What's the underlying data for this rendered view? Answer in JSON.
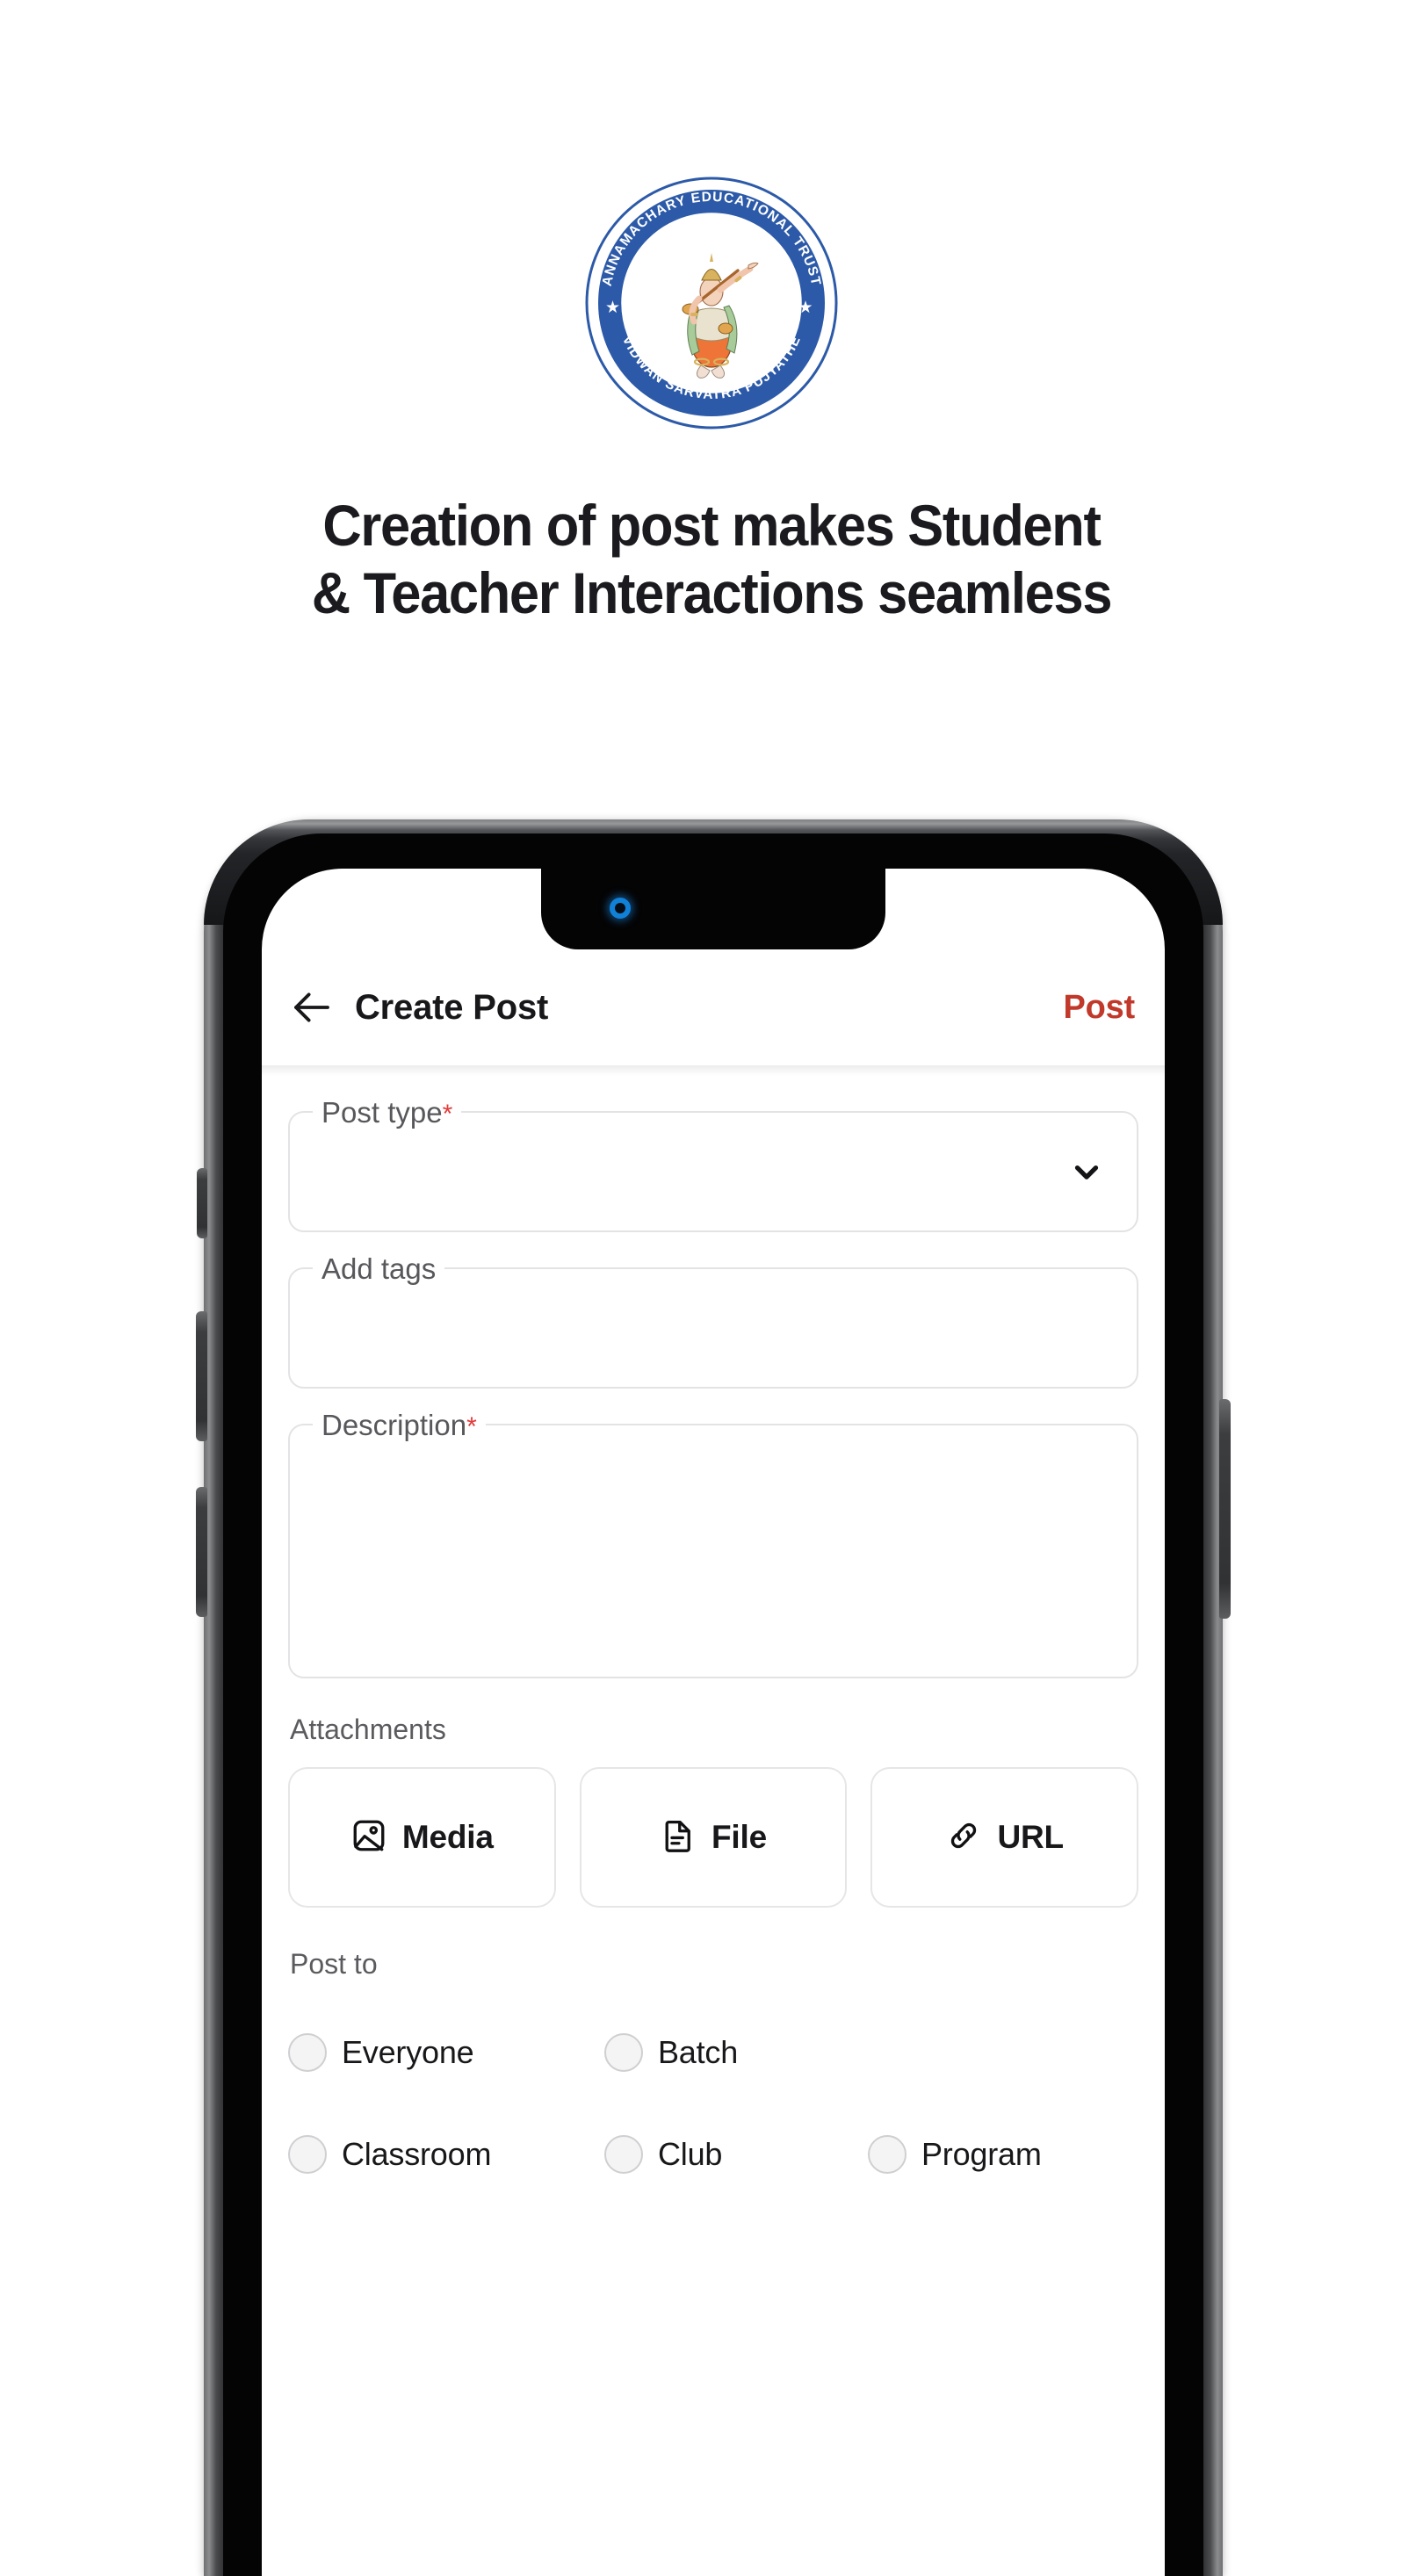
{
  "hero": {
    "logo": {
      "name": "annamachary-educational-trust-logo",
      "top_arc_text": "ANNAMACHARY EDUCATIONAL TRUST",
      "bottom_arc_text": "VIDWAN SARVATRA PUJYATHE",
      "ring_color": "#2c5aa8",
      "star_glyph": "★"
    },
    "headline_line1": "Creation of post makes Student",
    "headline_line2": "& Teacher Interactions seamless"
  },
  "phone": {
    "appbar": {
      "back_icon": "arrow-left-icon",
      "title": "Create Post",
      "action_label": "Post",
      "action_color": "#c0392b"
    },
    "form": {
      "fields": [
        {
          "label": "Post type",
          "required": true,
          "required_mark": "*",
          "value": "",
          "control": "dropdown",
          "icon": "chevron-down-icon"
        },
        {
          "label": "Add tags",
          "required": false,
          "required_mark": "",
          "value": "",
          "control": "text",
          "icon": ""
        },
        {
          "label": "Description",
          "required": true,
          "required_mark": "*",
          "value": "",
          "control": "textarea",
          "icon": ""
        }
      ],
      "attachments": {
        "label": "Attachments",
        "buttons": [
          {
            "label": "Media",
            "icon": "image-icon"
          },
          {
            "label": "File",
            "icon": "document-icon"
          },
          {
            "label": "URL",
            "icon": "link-icon"
          }
        ]
      },
      "post_to": {
        "label": "Post to",
        "options": [
          {
            "label": "Everyone",
            "selected": false
          },
          {
            "label": "Batch",
            "selected": false
          },
          {
            "label": "Classroom",
            "selected": false
          },
          {
            "label": "Club",
            "selected": false
          },
          {
            "label": "Program",
            "selected": false
          }
        ]
      }
    },
    "hardware": {
      "speaker": "earpiece-speaker",
      "camera": "front-camera",
      "buttons": [
        "mute-switch",
        "volume-up-button",
        "volume-down-button",
        "power-button"
      ]
    }
  }
}
